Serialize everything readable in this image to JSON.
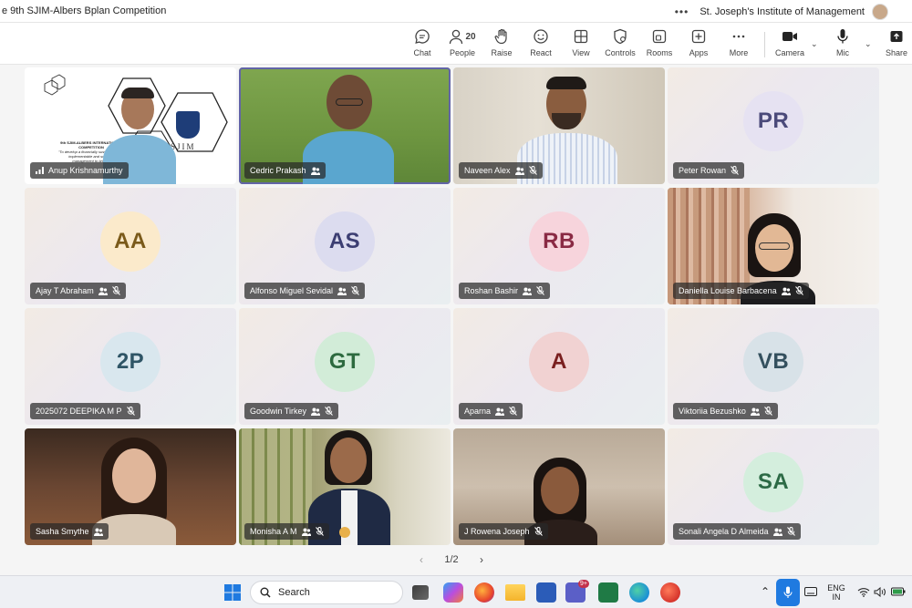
{
  "window": {
    "title": "e 9th SJIM-Albers Bplan Competition",
    "organization": "St. Joseph's Institute of Management",
    "more_dots": "•••"
  },
  "toolbar": {
    "chat": "Chat",
    "people": "People",
    "people_count": "20",
    "raise": "Raise",
    "react": "React",
    "view": "View",
    "controls": "Controls",
    "rooms": "Rooms",
    "apps": "Apps",
    "more": "More",
    "camera": "Camera",
    "mic": "Mic",
    "share": "Share"
  },
  "tiles": [
    {
      "name": "Anup Krishnamurthy",
      "type": "video",
      "signal": true
    },
    {
      "name": "Cedric Prakash",
      "type": "video",
      "active": true
    },
    {
      "name": "Naveen Alex",
      "type": "video",
      "muted": true
    },
    {
      "name": "Peter Rowan",
      "initials": "PR",
      "muted": true
    },
    {
      "name": "Ajay T Abraham",
      "initials": "AA",
      "muted": true
    },
    {
      "name": "Alfonso Miguel Sevidal",
      "initials": "AS",
      "muted": true
    },
    {
      "name": "Roshan Bashir",
      "initials": "RB",
      "muted": true
    },
    {
      "name": "Daniella Louise Barbacena",
      "type": "video",
      "muted": true
    },
    {
      "name": "2025072 DEEPIKA M P",
      "initials": "2P",
      "muted": true
    },
    {
      "name": "Goodwin Tirkey",
      "initials": "GT",
      "muted": true
    },
    {
      "name": "Aparna",
      "initials": "A",
      "muted": true
    },
    {
      "name": "Viktoriia Bezushko",
      "initials": "VB",
      "muted": true
    },
    {
      "name": "Sasha Smythe",
      "type": "video"
    },
    {
      "name": "Monisha A M",
      "type": "video",
      "muted": true
    },
    {
      "name": "J Rowena Joseph",
      "type": "video",
      "muted": true
    },
    {
      "name": "Sonali Angela D Almeida",
      "initials": "SA",
      "muted": true
    }
  ],
  "anup_slide": {
    "line1": "9th SJIM-ALBERS INTERNATIONAL",
    "line2": "COMPETITION",
    "line3": "\"To develop a financially sustainable and",
    "line4": "implementable and scalable",
    "line5": "management to bring a",
    "logo_text": "SJIM"
  },
  "pager": {
    "label": "1/2"
  },
  "taskbar": {
    "search_placeholder": "Search",
    "lang_top": "ENG",
    "lang_bottom": "IN",
    "teams_badge": "9+"
  },
  "colors": {
    "accent": "#6264a7",
    "PR": {
      "bg": "#e6e2f2",
      "fg": "#4b4a7a"
    },
    "AA": {
      "bg": "#fbeacb",
      "fg": "#7a5a1a"
    },
    "AS": {
      "bg": "#dcdcef",
      "fg": "#3c3e72"
    },
    "RB": {
      "bg": "#f7d4dc",
      "fg": "#8a2a44"
    },
    "2P": {
      "bg": "#d9e7ee",
      "fg": "#2f5566"
    },
    "GT": {
      "bg": "#d2ecd8",
      "fg": "#2d6a3f"
    },
    "A": {
      "bg": "#f1d2d2",
      "fg": "#7a1f1f"
    },
    "VB": {
      "bg": "#d8e2e8",
      "fg": "#34505e"
    },
    "SA": {
      "bg": "#d4eedd",
      "fg": "#2c6a45"
    }
  }
}
